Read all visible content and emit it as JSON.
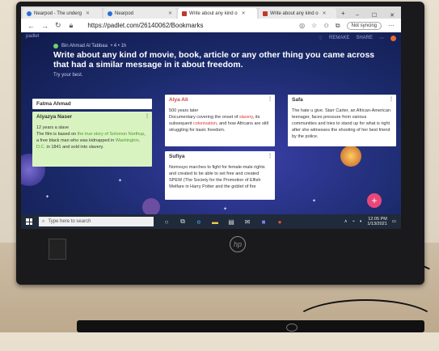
{
  "browser": {
    "tabs": [
      {
        "label": "Nearpod - The underg",
        "icon": "nearpod-icon",
        "active": false
      },
      {
        "label": "Nearpod",
        "icon": "nearpod-icon",
        "active": false
      },
      {
        "label": "Write about any kind o",
        "icon": "padlet-icon",
        "active": true
      },
      {
        "label": "Write about any kind o",
        "icon": "padlet-icon",
        "active": false
      }
    ],
    "new_tab": "+",
    "url": "https://padlet.com/26140062/Bookmarks",
    "sync_label": "Not syncing"
  },
  "padlet": {
    "logo": "padlet",
    "top_right": [
      "REMAKE",
      "SHARE"
    ],
    "author": "Bin Ahmad Al Tabbaa",
    "meta": "• 4  • 1h",
    "title": "Write about any kind of movie, book, article or any other thing you came across that had a similar message in it about freedom.",
    "subtitle": "Try your best.",
    "fab": "+"
  },
  "cards": [
    {
      "key": "fatma",
      "title": "Fatma Ahmad",
      "body": ""
    },
    {
      "key": "alyazya",
      "title": "Alyazya Naser",
      "body_parts": [
        {
          "t": "12 years a slave",
          "c": ""
        },
        {
          "t": "The film is based on ",
          "c": ""
        },
        {
          "t": "the true story of Solomon Northup",
          "c": "hl-link"
        },
        {
          "t": ", a free black man who was kidnapped in ",
          "c": ""
        },
        {
          "t": "Washington, D.C.",
          "c": "hl-link"
        },
        {
          "t": " in 1841 and sold into slavery.",
          "c": ""
        }
      ]
    },
    {
      "key": "alya",
      "title": "Alya Ali",
      "body_parts": [
        {
          "t": "500 years later",
          "c": ""
        },
        {
          "t": "Documentary covering the onset of ",
          "c": ""
        },
        {
          "t": "slavery",
          "c": "hl-red"
        },
        {
          "t": ", its subsequent ",
          "c": ""
        },
        {
          "t": "colonisation",
          "c": "hl-red"
        },
        {
          "t": ", and how Africans are still struggling for basic freedom.",
          "c": ""
        }
      ]
    },
    {
      "key": "sufiya",
      "title": "Sufiya",
      "body": "Nomvuyo marches to fight for female-male rights and created to be able to set free and created SPEW (The Society for the Promotion of Elfish Welfare in Harry Potter and the goblet of fire"
    },
    {
      "key": "safa",
      "title": "Safa",
      "body": "The hate u give. Starr Carter, an African-American teenager, faces pressure from various communities and tries to stand up for what is right after she witnesses the shooting of her best friend by the police."
    }
  ],
  "taskbar": {
    "search_placeholder": "Type here to search",
    "time": "12:05 PM",
    "date": "1/13/2021"
  },
  "monitor": {
    "brand": "hp"
  }
}
